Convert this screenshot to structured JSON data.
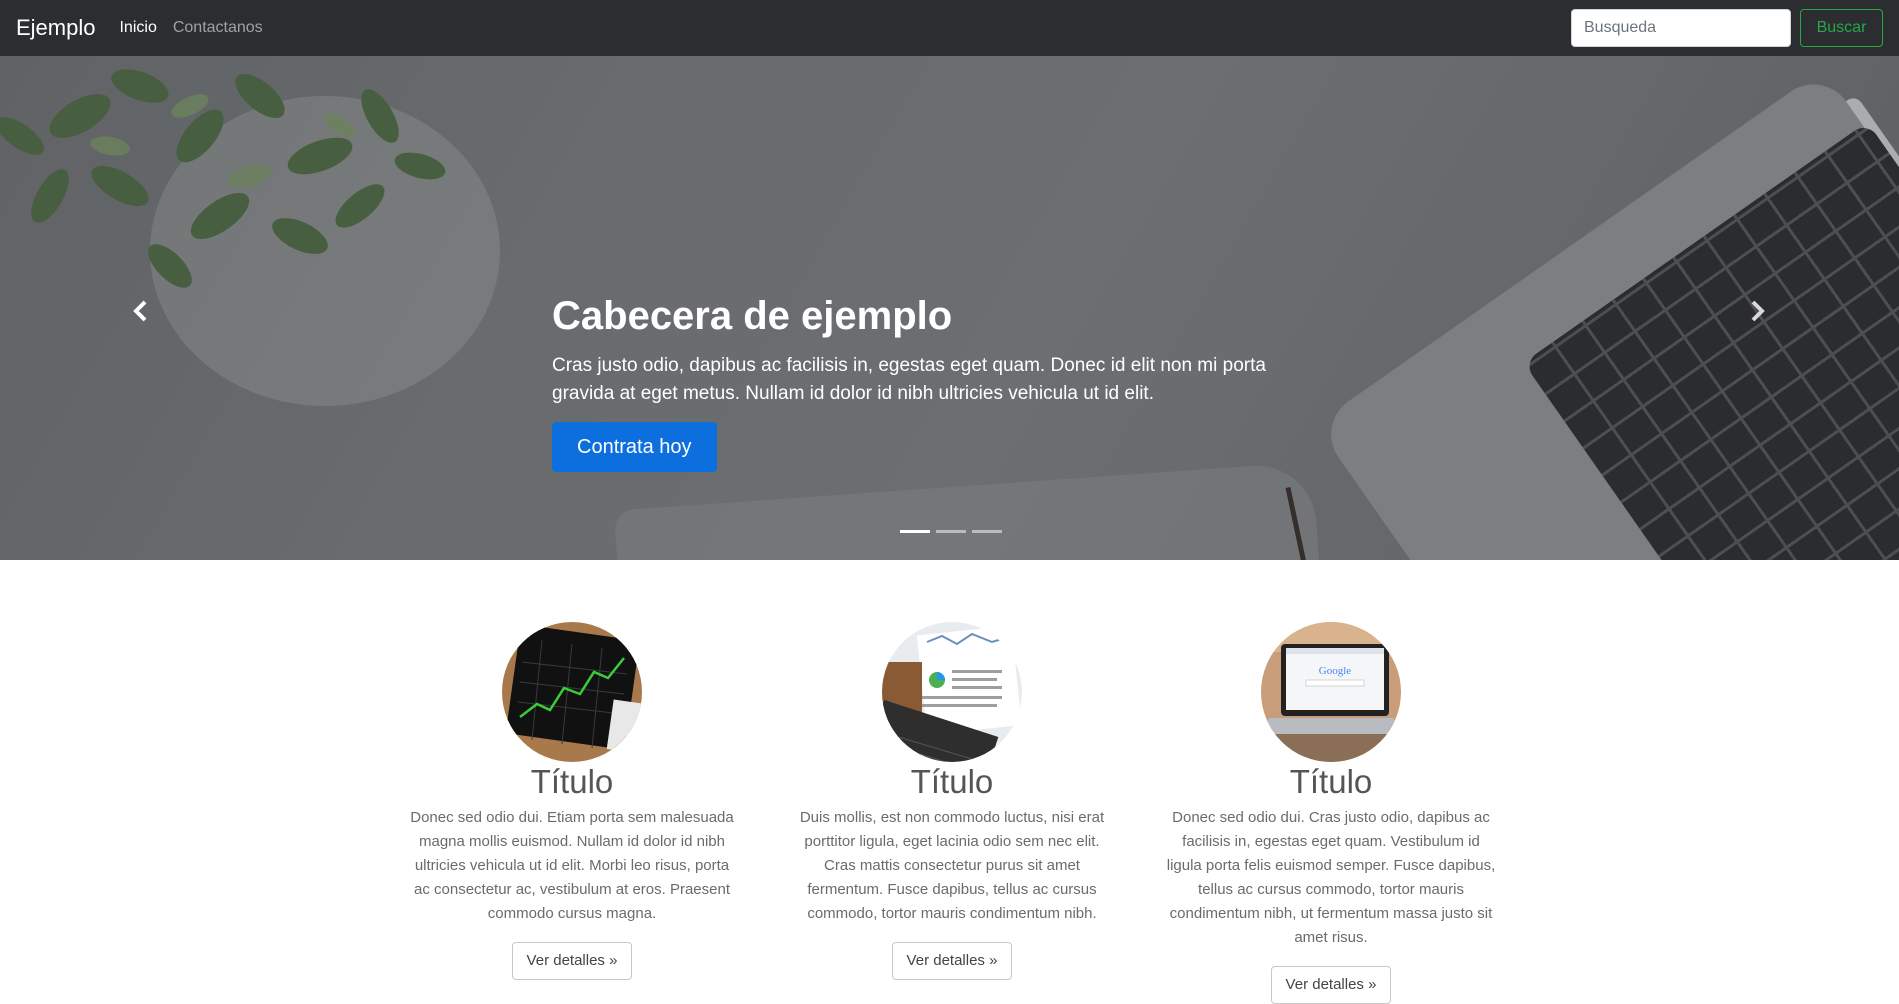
{
  "navbar": {
    "brand": "Ejemplo",
    "links": [
      {
        "label": "Inicio",
        "active": true
      },
      {
        "label": "Contactanos",
        "active": false
      }
    ],
    "search_placeholder": "Busqueda",
    "search_button": "Buscar"
  },
  "hero": {
    "title": "Cabecera de ejemplo",
    "text": "Cras justo odio, dapibus ac facilisis in, egestas eget quam. Donec id elit non mi porta gravida at eget metus. Nullam id dolor id nibh ultricies vehicula ut id elit.",
    "button": "Contrata hoy",
    "active_slide": 1,
    "slide_count": 3
  },
  "features": [
    {
      "title": "Título",
      "text": "Donec sed odio dui. Etiam porta sem malesuada magna mollis euismod. Nullam id dolor id nibh ultricies vehicula ut id elit. Morbi leo risus, porta ac consectetur ac, vestibulum at eros. Praesent commodo cursus magna.",
      "button": "Ver detalles »"
    },
    {
      "title": "Título",
      "text": "Duis mollis, est non commodo luctus, nisi erat porttitor ligula, eget lacinia odio sem nec elit. Cras mattis consectetur purus sit amet fermentum. Fusce dapibus, tellus ac cursus commodo, tortor mauris condimentum nibh.",
      "button": "Ver detalles »"
    },
    {
      "title": "Título",
      "text": "Donec sed odio dui. Cras justo odio, dapibus ac facilisis in, egestas eget quam. Vestibulum id ligula porta felis euismod semper. Fusce dapibus, tellus ac cursus commodo, tortor mauris condimentum nibh, ut fermentum massa justo sit amet risus.",
      "button": "Ver detalles »"
    }
  ],
  "colors": {
    "navbar_bg": "#2b2d30",
    "primary": "#0d6fde",
    "success": "#28a745"
  }
}
